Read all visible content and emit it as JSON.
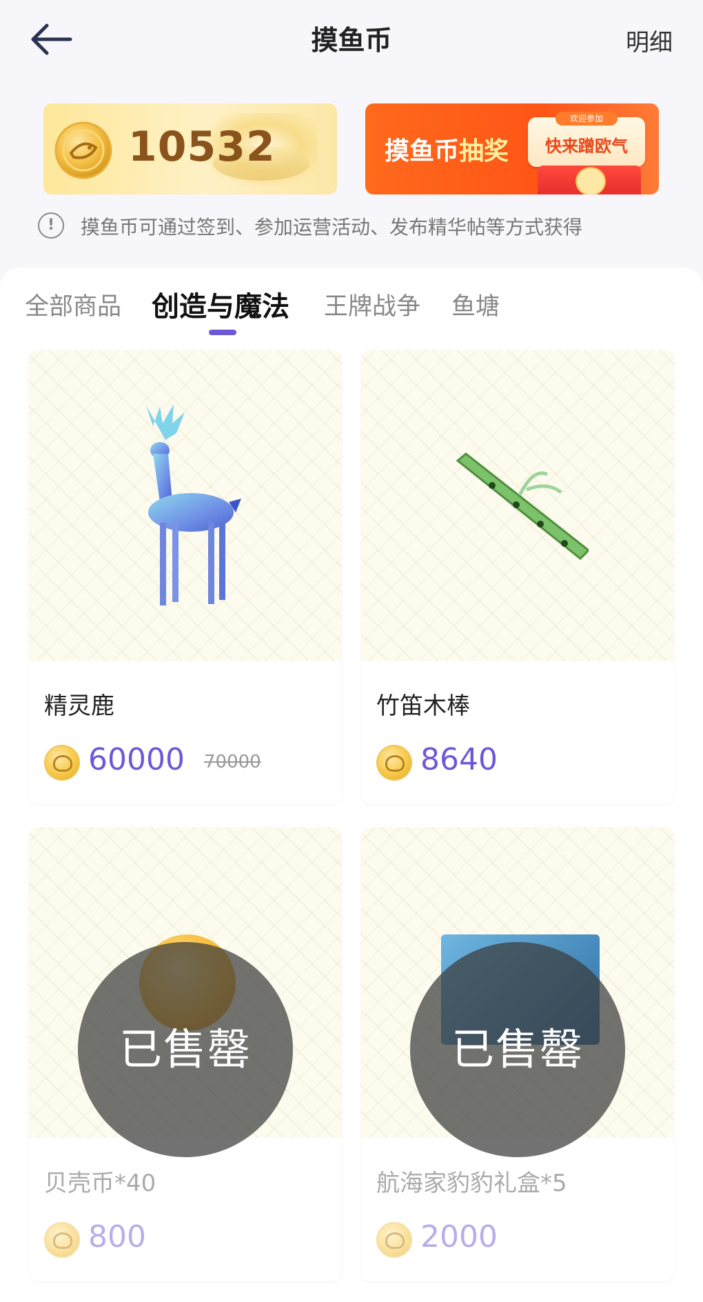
{
  "header": {
    "title": "摸鱼币",
    "detail_label": "明细"
  },
  "banners": {
    "balance": "10532",
    "lottery_label_prefix": "摸鱼币",
    "lottery_label_highlight": "抽奖",
    "lottery_tag": "欢迎参加",
    "lottery_card_text": "快来蹭欧气"
  },
  "info": {
    "text": "摸鱼币可通过签到、参加运营活动、发布精华帖等方式获得"
  },
  "tabs": [
    {
      "label": "全部商品",
      "active": false
    },
    {
      "label": "创造与魔法",
      "active": true
    },
    {
      "label": "王牌战争",
      "active": false
    },
    {
      "label": "鱼塘",
      "active": false
    }
  ],
  "products": [
    {
      "name": "精灵鹿",
      "price": "60000",
      "original_price": "70000",
      "sold_out": false,
      "image": "spirit-deer"
    },
    {
      "name": "竹笛木棒",
      "price": "8640",
      "sold_out": false,
      "image": "bamboo-flute"
    },
    {
      "name": "贝壳币*40",
      "price": "800",
      "sold_out": true,
      "sold_label": "已售罄",
      "image": "shell-coin"
    },
    {
      "name": "航海家豹豹礼盒*5",
      "price": "2000",
      "sold_out": true,
      "sold_label": "已售罄",
      "image": "navigator-gift-box"
    }
  ],
  "colors": {
    "accent": "#6c59d6",
    "price": "#7156d6",
    "background": "#f6f6fb"
  }
}
